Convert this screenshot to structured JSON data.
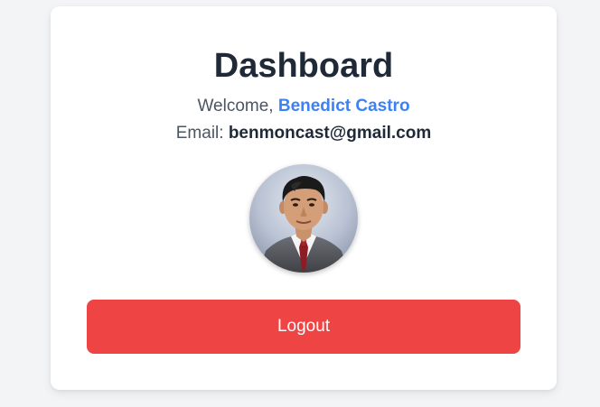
{
  "page": {
    "title": "Dashboard"
  },
  "welcome": {
    "prefix": "Welcome, ",
    "user_name": "Benedict Castro"
  },
  "email": {
    "label": "Email: ",
    "value": "benmoncast@gmail.com"
  },
  "avatar": {
    "icon": "profile-photo"
  },
  "logout": {
    "label": "Logout"
  },
  "colors": {
    "background": "#f3f4f6",
    "card": "#ffffff",
    "title": "#1f2937",
    "accent": "#3b82f6",
    "danger": "#ef4444"
  }
}
